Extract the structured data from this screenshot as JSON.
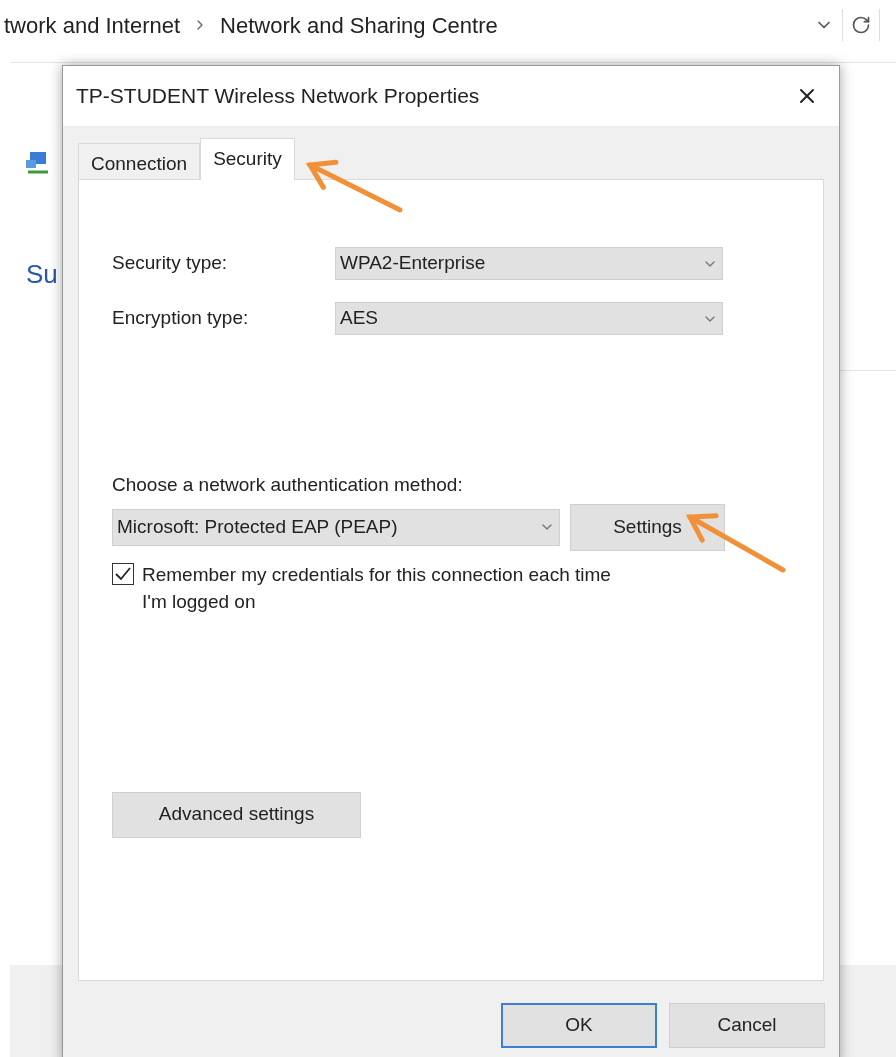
{
  "address_bar": {
    "breadcrumb": [
      "twork and Internet",
      "Network and Sharing Centre"
    ]
  },
  "background_link": "Su",
  "dialog": {
    "title": "TP-STUDENT Wireless Network Properties",
    "tabs": [
      {
        "label": "Connection",
        "selected": false
      },
      {
        "label": "Security",
        "selected": true
      }
    ],
    "fields": [
      {
        "label": "Security type:",
        "value": "WPA2-Enterprise"
      },
      {
        "label": "Encryption type:",
        "value": "AES"
      }
    ],
    "auth": {
      "label": "Choose a network authentication method:",
      "value": "Microsoft: Protected EAP (PEAP)",
      "button": "Settings"
    },
    "remember": {
      "label": "Remember my credentials for this connection each time I'm logged on",
      "checked": true
    },
    "advanced_button": "Advanced settings",
    "buttons": [
      {
        "label": "OK",
        "default": true
      },
      {
        "label": "Cancel",
        "default": false
      }
    ]
  }
}
